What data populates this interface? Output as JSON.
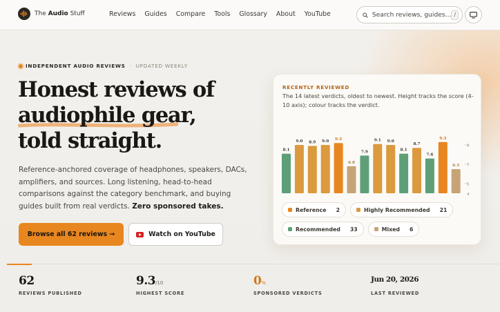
{
  "brand": {
    "prefix": "The",
    "strong": "Audio",
    "suffix": "Stuff"
  },
  "nav": [
    "Reviews",
    "Guides",
    "Compare",
    "Tools",
    "Glossary",
    "About",
    "YouTube"
  ],
  "search": {
    "placeholder": "Search reviews, guides...",
    "shortcut": "/"
  },
  "hero": {
    "eyebrow": "INDEPENDENT AUDIO REVIEWS",
    "eyebrow_sub": "UPDATED WEEKLY",
    "title_line1": "Honest reviews of",
    "title_line2": "audiophile gear,",
    "title_line3": "told straight.",
    "lede": "Reference-anchored coverage of headphones, speakers, DACs, amplifiers, and sources. Long listening, head-to-head comparisons against the category benchmark, and buying guides built from real verdicts.",
    "lede_strong": "Zero sponsored takes.",
    "cta_primary": "Browse all 62 reviews →",
    "cta_secondary": "Watch on YouTube"
  },
  "colors": {
    "accent": "#e8861f",
    "reference": "#e8861f",
    "highly_recommended": "#db9a3e",
    "recommended": "#5e9f78",
    "mixed": "#c7a477"
  },
  "card": {
    "title": "RECENTLY REVIEWED",
    "desc": "The 14 latest verdicts, oldest to newest. Height tracks the score (4-10 axis); colour tracks the verdict."
  },
  "chart_data": {
    "type": "bar",
    "ylim": [
      4,
      10
    ],
    "yticks": [
      5,
      7,
      9
    ],
    "values": [
      8.1,
      9.0,
      8.9,
      9.0,
      9.2,
      6.8,
      7.9,
      9.1,
      9.0,
      8.1,
      8.7,
      7.6,
      9.3,
      6.5
    ],
    "verdicts": [
      "recommended",
      "highly_recommended",
      "highly_recommended",
      "highly_recommended",
      "reference",
      "mixed",
      "recommended",
      "highly_recommended",
      "highly_recommended",
      "recommended",
      "highly_recommended",
      "recommended",
      "reference",
      "mixed"
    ],
    "legend": [
      {
        "key": "reference",
        "name": "Reference",
        "count": "2"
      },
      {
        "key": "highly_recommended",
        "name": "Highly Recommended",
        "count": "21"
      },
      {
        "key": "recommended",
        "name": "Recommended",
        "count": "33"
      },
      {
        "key": "mixed",
        "name": "Mixed",
        "count": "6"
      }
    ]
  },
  "stats": [
    {
      "value": "62",
      "suffix": "",
      "label": "REVIEWS PUBLISHED"
    },
    {
      "value": "9.3",
      "suffix": "/10",
      "label": "HIGHEST SCORE"
    },
    {
      "value": "0",
      "suffix": "%",
      "label": "SPONSORED VERDICTS"
    },
    {
      "value": "Jun 20, 2026",
      "suffix": "",
      "label": "LAST REVIEWED"
    }
  ]
}
